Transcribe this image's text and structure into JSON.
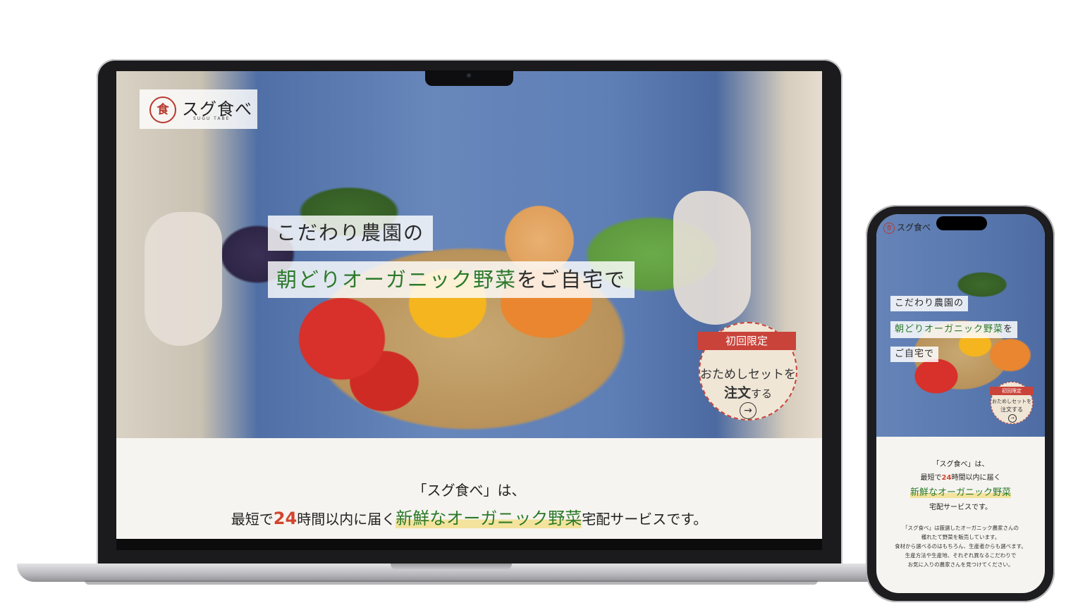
{
  "logo": {
    "mark": "食",
    "name": "スグ食べ",
    "sub": "SUGU TABE"
  },
  "hero": {
    "copy_line1": "こだわり農園の",
    "copy_line2_green": "朝どりオーガニック野菜",
    "copy_line2_rest": "をご自宅で"
  },
  "badge": {
    "ribbon": "初回限定",
    "line1": "おためしセットを",
    "line2_bold": "注文",
    "line2_rest": "する",
    "arrow": "→"
  },
  "lead": {
    "line1": "「スグ食べ」は、",
    "pre": "最短で",
    "num": "24",
    "mid": "時間以内に届く",
    "highlight": "新鮮なオーガニック野菜",
    "post": "宅配サービスです。"
  },
  "phone": {
    "logo_name": "スグ食べ",
    "copy_line1": "こだわり農園の",
    "copy_line2_green": "朝どりオーガニック野菜",
    "copy_line2_rest": "を",
    "copy_line3": "ご自宅で",
    "badge_ribbon": "初回限定",
    "badge_line1": "おためしセットを",
    "badge_line2": "注文する",
    "lead1": "「スグ食べ」は、",
    "lead2_pre": "最短で",
    "lead2_num": "24",
    "lead2_post": "時間以内に届く",
    "lead3": "新鮮なオーガニック野菜",
    "lead4": "宅配サービスです。",
    "body": [
      "「スグ食べ」は厳選したオーガニック農家さんの",
      "穫れたて野菜を販売しています。",
      "食材から選べるのはもちろん、生産者からも選べます。",
      "生産方法や生産地、それぞれ異なるこだわりで",
      "お気に入りの農家さんを見つけてください。"
    ]
  },
  "colors": {
    "accent_red": "#c9433a",
    "accent_green": "#2c7a2a",
    "highlight": "#f3e39c"
  }
}
